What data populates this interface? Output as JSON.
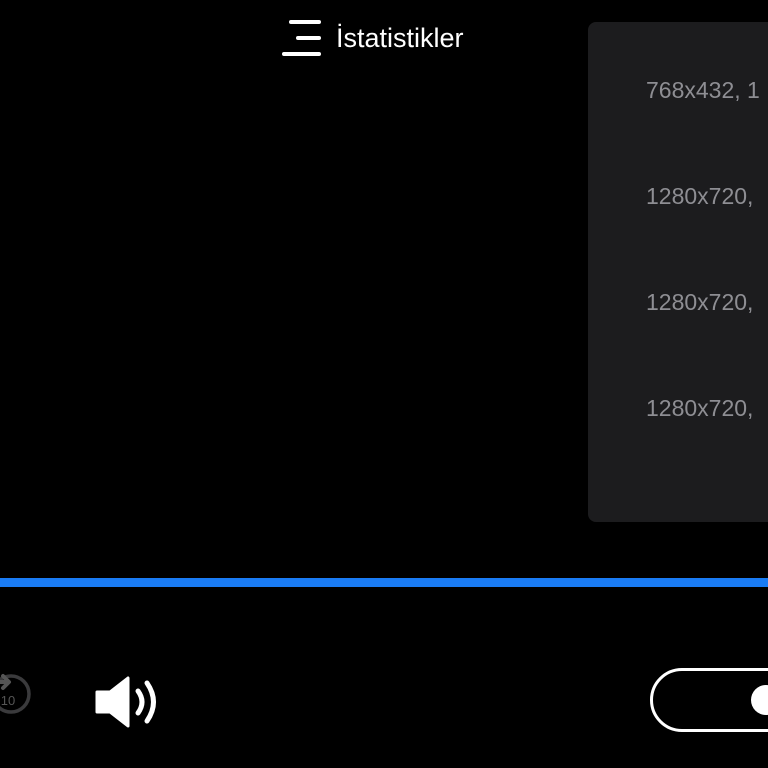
{
  "header": {
    "title": "İstatistikler",
    "icon": "stats-menu-icon"
  },
  "resolution_menu": {
    "items": [
      {
        "label": "768x432, 1"
      },
      {
        "label": "1280x720,"
      },
      {
        "label": "1280x720,"
      },
      {
        "label": "1280x720,"
      }
    ]
  },
  "progress": {
    "fraction": 1.0
  },
  "controls": {
    "skip_forward_seconds": "10",
    "skip_icon": "skip-forward-10-icon",
    "volume_icon": "volume-icon",
    "toggle_state": "on"
  },
  "colors": {
    "background": "#000000",
    "accent": "#1a7cf5",
    "panel": "#1c1c1e",
    "menu_text": "#8e8e93"
  }
}
